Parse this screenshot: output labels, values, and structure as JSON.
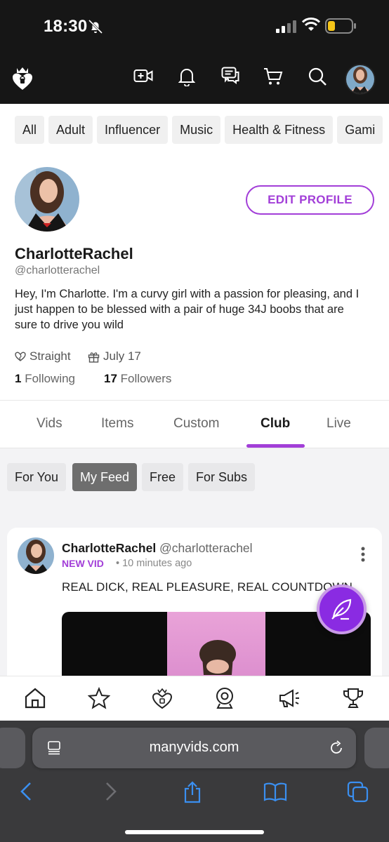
{
  "status_bar": {
    "time": "18:30"
  },
  "header": {
    "icons": [
      "logo-icon",
      "video-add-icon",
      "bell-icon",
      "chat-icon",
      "cart-icon",
      "search-icon",
      "avatar"
    ]
  },
  "categories": [
    "All",
    "Adult",
    "Influencer",
    "Music",
    "Health & Fitness",
    "Gami"
  ],
  "profile": {
    "name": "CharlotteRachel",
    "handle": "@charlotterachel",
    "edit_label": "EDIT PROFILE",
    "bio": "Hey, I'm Charlotte. I'm a curvy girl with a passion for pleasing, and I just happen to be blessed with a pair of huge 34J boobs that are sure to drive you wild",
    "orientation": "Straight",
    "birthday": "July 17",
    "following_count": "1",
    "following_label": "Following",
    "followers_count": "17",
    "followers_label": "Followers"
  },
  "tabs": [
    "Vids",
    "Items",
    "Custom",
    "Club",
    "Live"
  ],
  "active_tab": "Club",
  "feed_filters": [
    "For You",
    "My Feed",
    "Free",
    "For Subs"
  ],
  "active_filter": "My Feed",
  "post": {
    "author": "CharlotteRachel",
    "handle": "@charlotterachel",
    "badge": "NEW VID",
    "separator": "•",
    "time": "10 minutes ago",
    "text": "REAL DICK, REAL PLEASURE, REAL COUNTDOWN"
  },
  "bottom_nav": [
    "home-icon",
    "star-icon",
    "lock-heart-icon",
    "webcam-icon",
    "megaphone-icon",
    "trophy-icon"
  ],
  "browser": {
    "url": "manyvids.com"
  },
  "colors": {
    "accent": "#a23ed8",
    "header_bg": "#161616"
  }
}
